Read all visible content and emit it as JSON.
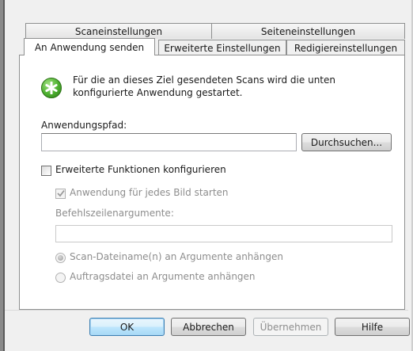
{
  "tabs": {
    "row1": [
      "Scaneinstellungen",
      "Seiteneinstellungen"
    ],
    "row2": [
      "An Anwendung senden",
      "Erweiterte Einstellungen",
      "Redigiereinstellungen"
    ]
  },
  "info": {
    "line1": "Für die an dieses Ziel gesendeten Scans wird die unten",
    "line2": "konfigurierte Anwendung gestartet.",
    "icon": "green-star-info-icon"
  },
  "path": {
    "label": "Anwendungspfad:",
    "value": "",
    "browse_label": "Durchsuchen..."
  },
  "advanced": {
    "label": "Erweiterte Funktionen konfigurieren",
    "checked": false,
    "per_image_label": "Anwendung für jedes Bild starten",
    "per_image_checked": true,
    "args_label": "Befehlszeilenargumente:",
    "args_value": "",
    "radio1_label": "Scan-Dateiname(n) an Argumente anhängen",
    "radio2_label": "Auftragsdatei an Argumente anhängen",
    "radio_selected": "radio1"
  },
  "buttons": {
    "ok": "OK",
    "cancel": "Abbrechen",
    "apply": "Übernehmen",
    "help": "Hilfe"
  },
  "colors": {
    "accent": "#3c7fb1",
    "icon_green": "#4caf2f",
    "disabled_text": "#8d8d8d"
  }
}
